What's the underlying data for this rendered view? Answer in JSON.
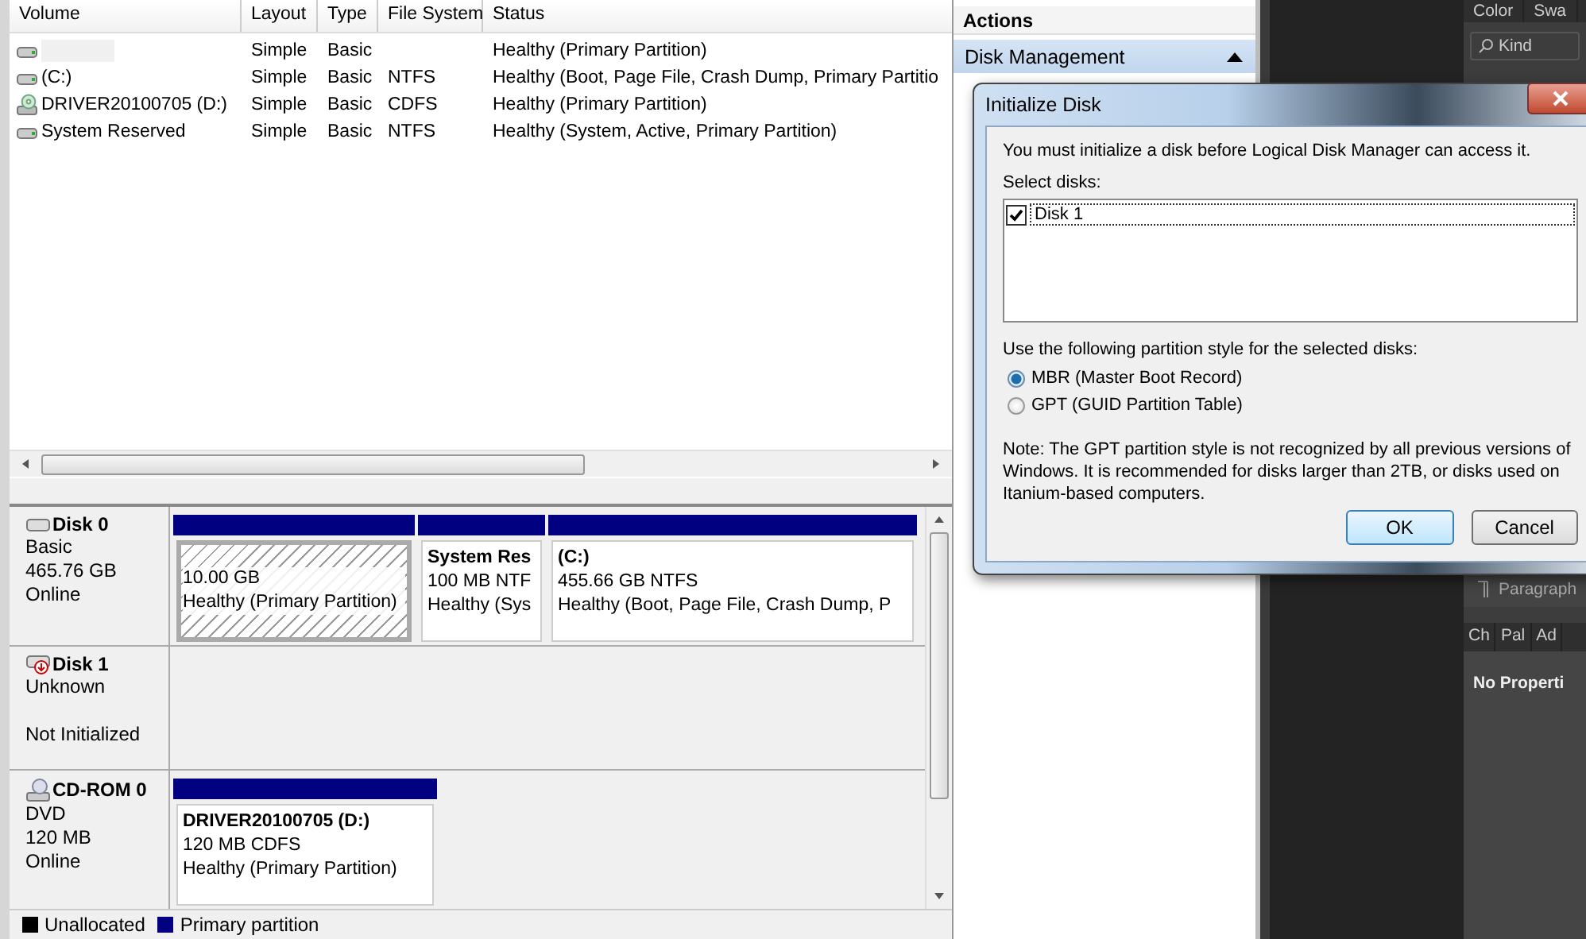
{
  "volume_table": {
    "columns": [
      "Volume",
      "Layout",
      "Type",
      "File System",
      "Status"
    ],
    "rows": [
      {
        "kind": "drive",
        "redacted": true,
        "layout": "Simple",
        "type": "Basic",
        "status": "Healthy (Primary Partition)"
      },
      {
        "kind": "drive",
        "redacted": false,
        "volume": "(C:)",
        "layout": "Simple",
        "type": "Basic",
        "file_system": "NTFS",
        "status": "Healthy (Boot, Page File, Crash Dump, Primary Partitio"
      },
      {
        "kind": "cd",
        "redacted": false,
        "volume": "DRIVER20100705 (D:)",
        "layout": "Simple",
        "type": "Basic",
        "file_system": "CDFS",
        "status": "Healthy (Primary Partition)"
      },
      {
        "kind": "drive",
        "redacted": false,
        "volume": "System Reserved",
        "layout": "Simple",
        "type": "Basic",
        "file_system": "NTFS",
        "status": "Healthy (System, Active, Primary Partition)"
      }
    ]
  },
  "disks": [
    {
      "kind": "drive",
      "name": "Disk 0",
      "type": "Basic",
      "size": "465.76 GB",
      "status": "Online",
      "partitions": [
        {
          "selected": true,
          "lines": [
            "10.00 GB",
            "Healthy (Primary Partition)"
          ]
        },
        {
          "selected": false,
          "title": "System Res",
          "lines": [
            "100 MB NTF",
            "Healthy (Sys"
          ]
        },
        {
          "selected": false,
          "title": "(C:)",
          "lines": [
            "455.66 GB NTFS",
            "Healthy (Boot, Page File, Crash Dump, P"
          ]
        }
      ]
    },
    {
      "kind": "disk-alert",
      "name": "Disk 1",
      "type": "Unknown",
      "status": "Not Initialized"
    },
    {
      "kind": "cd",
      "name": "CD-ROM 0",
      "type": "DVD",
      "size": "120 MB",
      "status": "Online",
      "partitions": [
        {
          "selected": false,
          "title": "DRIVER20100705  (D:)",
          "lines": [
            "120 MB CDFS",
            "Healthy (Primary Partition)"
          ]
        }
      ]
    }
  ],
  "legend": [
    {
      "label": "Unallocated",
      "color": "#000000"
    },
    {
      "label": "Primary partition",
      "color": "#000080"
    }
  ],
  "actions": {
    "title": "Actions",
    "items": [
      {
        "label": "Disk Management",
        "expanded": true
      }
    ]
  },
  "side_panel": {
    "tabs": [
      "Color",
      "Swa"
    ],
    "search": "Kind",
    "section": "Paragraph",
    "sub_tabs": [
      "Ch",
      "Pal",
      "Ad"
    ],
    "message": "No Properti"
  },
  "dialog": {
    "title": "Initialize Disk",
    "intro": "You must initialize a disk before Logical Disk Manager can access it.",
    "select_label": "Select disks:",
    "disks": [
      {
        "label": "Disk 1",
        "checked": true
      }
    ],
    "style_label": "Use the following partition style for the selected disks:",
    "options": [
      {
        "label": "MBR (Master Boot Record)",
        "selected": true
      },
      {
        "label": "GPT (GUID Partition Table)",
        "selected": false
      }
    ],
    "note": "Note: The GPT partition style is not recognized by all previous versions of Windows. It is recommended for disks larger than 2TB, or disks used on Itanium-based computers.",
    "buttons": [
      {
        "label": "OK",
        "default": true
      },
      {
        "label": "Cancel",
        "default": false
      }
    ]
  }
}
